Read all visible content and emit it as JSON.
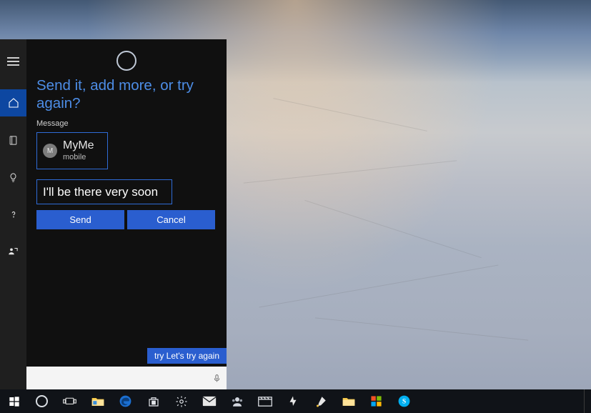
{
  "cortana": {
    "prompt": "Send it, add more, or try again?",
    "message_label": "Message",
    "contact": {
      "initial": "M",
      "name": "MyMe",
      "type": "mobile"
    },
    "message_input_value": "I'll be there very soon",
    "send_label": "Send",
    "cancel_label": "Cancel",
    "try_tip": "try Let's try again"
  },
  "searchbox": {
    "placeholder": ""
  },
  "sidebar": {
    "items": [
      {
        "name": "menu"
      },
      {
        "name": "home"
      },
      {
        "name": "notebook"
      },
      {
        "name": "tips"
      },
      {
        "name": "help"
      },
      {
        "name": "feedback"
      }
    ]
  },
  "taskbar": {
    "items": [
      "start",
      "cortana",
      "task-view",
      "file-explorer",
      "edge",
      "store",
      "settings",
      "mail",
      "people",
      "movies",
      "tips-app",
      "paint",
      "file-explorer-2",
      "microsoft",
      "skype"
    ]
  }
}
